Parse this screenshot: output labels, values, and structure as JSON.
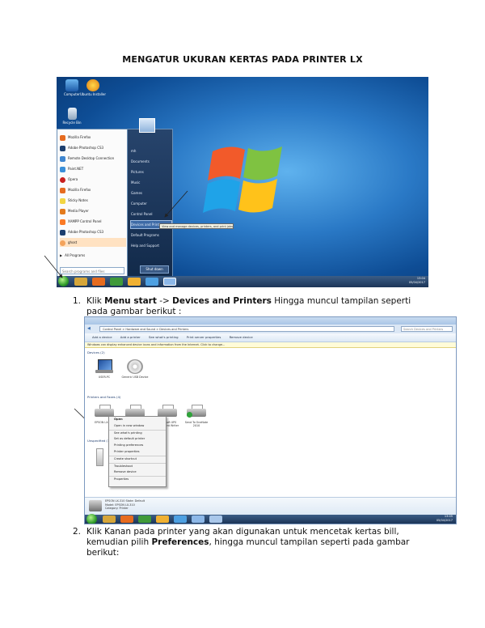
{
  "document": {
    "title": "MENGATUR UKURAN KERTAS PADA PRINTER LX"
  },
  "screenshot1": {
    "desktop_icons": [
      "Computer",
      "Ubuntu Installer",
      "Recycle Bin"
    ],
    "start_menu_left": [
      "Mozilla Firefox",
      "Adobe Photoshop CS3",
      "Remote Desktop Connection",
      "Paint.NET",
      "Opera",
      "Mozilla Firefox",
      "Sticky Notes",
      "Media Player",
      "XAMPP Control Panel",
      "Adobe Photoshop CS3",
      "ghost",
      "All Programs"
    ],
    "start_menu_right": [
      "mh",
      "Documents",
      "Pictures",
      "Music",
      "Games",
      "Computer",
      "Control Panel",
      "Devices and Printers",
      "Default Programs",
      "Help and Support"
    ],
    "search_placeholder": "Search programs and files",
    "shutdown_label": "Shut down",
    "tooltip": "View and manage devices, printers, and print jobs",
    "clock_time": "13:04",
    "clock_date": "05/04/2017"
  },
  "step1": {
    "number": "1.",
    "pre": "Klik ",
    "bold1": "Menu start",
    "mid": " -> ",
    "bold2": "Devices and Printers",
    "post": " Hingga muncul tampilan seperti pada gambar berikut :"
  },
  "screenshot2": {
    "address": "Control Panel > Hardware and Sound > Devices and Printers",
    "search_placeholder": "Search Devices and Printers",
    "toolbar": [
      "Add a device",
      "Add a printer",
      "See what's printing",
      "Print server properties",
      "Remove device"
    ],
    "infobar": "Windows can display enhanced device icons and information from the Internet. Click to change...",
    "group_devices": "Devices (2)",
    "group_printers": "Printers and Faxes (4)",
    "group_unspecified": "Unspecified (1)",
    "devices": [
      "USER-PC",
      "Generic USB Device"
    ],
    "printers": [
      "EPSON LX-310",
      "Fax",
      "Microsoft XPS Document Writer",
      "Send To OneNote 2010"
    ],
    "context_menu": [
      "Open",
      "Open in new window",
      "See what's printing",
      "Set as default printer",
      "Printing preferences",
      "Printer properties",
      "Create shortcut",
      "Troubleshoot",
      "Remove device",
      "Properties"
    ],
    "details": [
      "EPSON LX-310   State: Default",
      "Model: EPSON LX-310",
      "Category: Printer"
    ],
    "clock_time": "13:05",
    "clock_date": "05/04/2017"
  },
  "step2": {
    "number": "2.",
    "pre": "Klik Kanan pada printer yang akan digunakan untuk mencetak kertas bill, kemudian pilih ",
    "bold": "Preferences",
    "post": ", hingga muncul tampilan seperti pada gambar berikut:"
  }
}
